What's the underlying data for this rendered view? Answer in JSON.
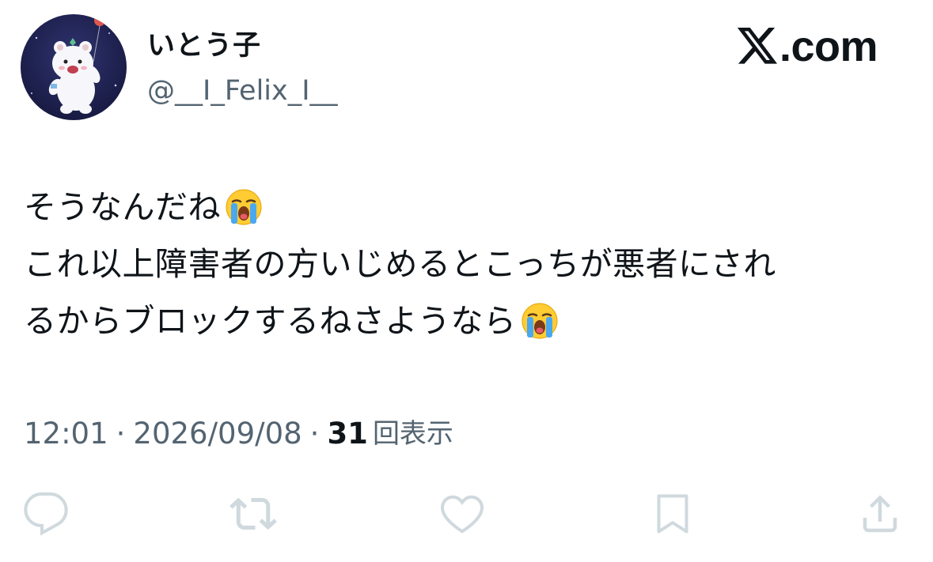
{
  "author": {
    "display_name": "いとう子",
    "handle": "@__I_Felix_I__",
    "avatar_icon": "bear-avatar-icon"
  },
  "brand": {
    "site_text": ".com",
    "logo_icon": "x-logo-icon"
  },
  "tweet": {
    "lines": [
      "そうなんだね",
      "これ以上障害者の方いじめるとこっちが悪者にされ",
      "るからブロックするねさようなら"
    ],
    "emoji_icon": "loudly-crying-face-icon"
  },
  "meta": {
    "time": "12:01",
    "separator": "·",
    "date": "2026/09/08",
    "view_count": "31",
    "view_label": "回表示"
  },
  "actions": [
    {
      "name": "reply",
      "icon": "reply-icon"
    },
    {
      "name": "repost",
      "icon": "repost-icon"
    },
    {
      "name": "like",
      "icon": "heart-icon"
    },
    {
      "name": "bookmark",
      "icon": "bookmark-icon"
    },
    {
      "name": "share",
      "icon": "share-icon"
    }
  ],
  "colors": {
    "text": "#0f1419",
    "secondary": "#536471",
    "action_icon": "#cfd9de",
    "avatar_bg": "#1c1f4a"
  }
}
